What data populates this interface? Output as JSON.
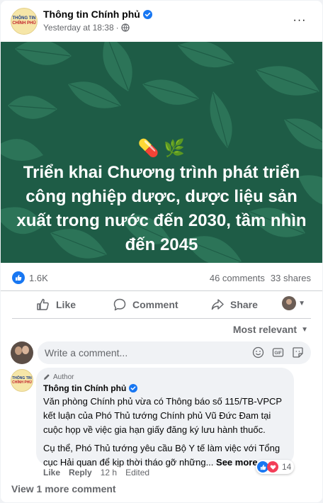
{
  "post": {
    "page_name": "Thông tin Chính phủ",
    "avatar_text_line1": "THÔNG TIN",
    "avatar_text_line2": "CHÍNH PHỦ",
    "timestamp": "Yesterday at 18:38",
    "meta_separator": "·",
    "privacy_icon": "globe-icon",
    "more_label": "···"
  },
  "banner": {
    "emojis": "💊 🌿",
    "title": "Triển khai Chương trình phát triển công nghiệp dược, dược liệu sản xuất trong nước đến 2030, tầm nhìn đến 2045",
    "background_color": "#1e5c46"
  },
  "stats": {
    "reactions": "1.6K",
    "comments": "46 comments",
    "shares": "33 shares"
  },
  "actions": {
    "like": "Like",
    "comment": "Comment",
    "share": "Share"
  },
  "comments_section": {
    "sort_label": "Most relevant",
    "composer_placeholder": "Write a comment...",
    "view_more": "View 1 more comment"
  },
  "top_comment": {
    "author_tag": "Author",
    "name": "Thông tin Chính phủ",
    "avatar_text_line1": "THÔNG TIN",
    "avatar_text_line2": "CHÍNH PHỦ",
    "paragraph1": "Văn phòng Chính phủ vừa có Thông báo số 115/TB-VPCP kết luận của Phó Thủ tướng Chính phủ Vũ Đức Đam tại cuộc họp về việc gia hạn giấy đăng ký lưu hành thuốc.",
    "paragraph2": "Cụ thể, Phó Thủ tướng yêu cầu Bộ Y tế làm việc với Tổng cục Hải quan để kịp thời tháo gỡ những...",
    "see_more": "See more",
    "like_label": "Like",
    "reply_label": "Reply",
    "time": "12 h",
    "edited": "Edited",
    "reaction_count": "14"
  },
  "colors": {
    "accent": "#1877f2",
    "heart": "#f33e58",
    "secondary_text": "#65676b"
  }
}
